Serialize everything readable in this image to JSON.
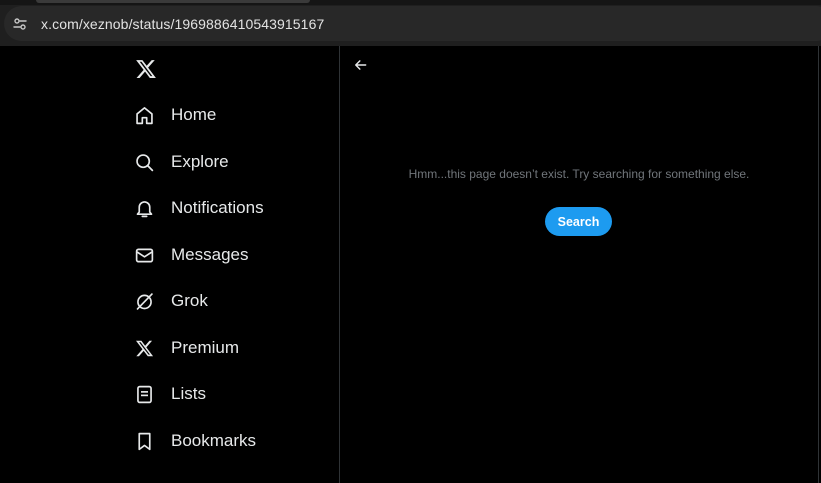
{
  "browser": {
    "url": "x.com/xeznob/status/1969886410543915167"
  },
  "sidebar": {
    "logo_icon": "x-logo-icon",
    "items": [
      {
        "label": "Home",
        "icon": "home-icon"
      },
      {
        "label": "Explore",
        "icon": "search-icon"
      },
      {
        "label": "Notifications",
        "icon": "bell-icon"
      },
      {
        "label": "Messages",
        "icon": "envelope-icon"
      },
      {
        "label": "Grok",
        "icon": "grok-icon"
      },
      {
        "label": "Premium",
        "icon": "x-logo-icon"
      },
      {
        "label": "Lists",
        "icon": "list-icon"
      },
      {
        "label": "Bookmarks",
        "icon": "bookmark-icon"
      }
    ]
  },
  "main": {
    "back_icon": "arrow-left-icon",
    "message": "Hmm...this page doesn’t exist. Try searching for something else.",
    "search_button_label": "Search"
  },
  "colors": {
    "background": "#000000",
    "text": "#e7e9ea",
    "muted_text": "#71767b",
    "accent": "#1d9bf0",
    "border": "#2f3336",
    "browser_chrome": "#1f1f1f",
    "address_bar": "#282828"
  }
}
